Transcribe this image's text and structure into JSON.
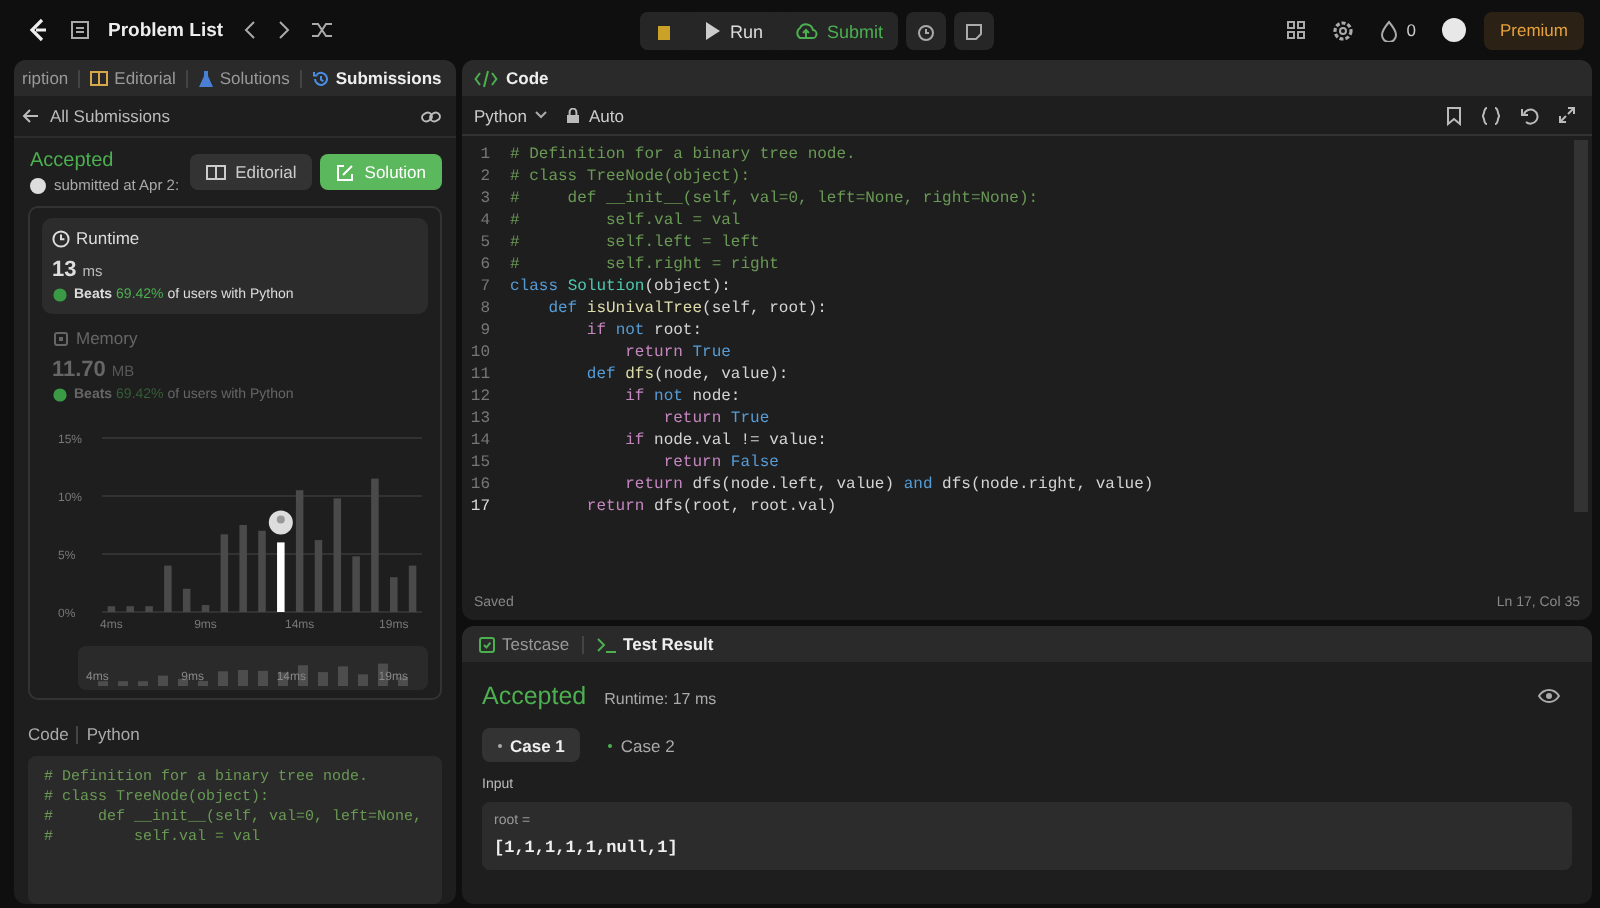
{
  "topbar": {
    "title": "Problem List",
    "run": "Run",
    "submit": "Submit",
    "streak": "0",
    "premium": "Premium"
  },
  "left": {
    "tabs": [
      {
        "label": "ription",
        "selected": false
      },
      {
        "label": "Editorial",
        "selected": false
      },
      {
        "label": "Solutions",
        "selected": false
      },
      {
        "label": "Submissions",
        "selected": true
      }
    ],
    "back": "All Submissions",
    "status": "Accepted",
    "submitted": "submitted at Apr 2:",
    "editorial_button": "Editorial",
    "solution_button": "Solution",
    "stats": [
      {
        "kind": "clock",
        "label": "Runtime",
        "value": "13",
        "unit": "ms",
        "beats": "Beats",
        "percent": "69.42%",
        "rest": "of users with Python",
        "selected": true
      },
      {
        "kind": "chip",
        "label": "Memory",
        "value": "11.70",
        "unit": "MB",
        "beats": "Beats",
        "percent": "69.42%",
        "rest": "of users with Python",
        "selected": false
      }
    ],
    "chart": {
      "chart_data": {
        "type": "bar",
        "stacked": true,
        "categories": [
          "4ms",
          null,
          null,
          null,
          null,
          "9ms",
          null,
          null,
          null,
          null,
          "14ms",
          null,
          null,
          null,
          null,
          "19ms",
          null
        ],
        "series": [
          {
            "color": "#4a4a4a",
            "values": [
              0.5,
              0.5,
              0.5,
              4,
              2,
              0.6,
              6.7,
              7.5,
              7,
              null,
              10.5,
              6.2,
              9.8,
              4.8,
              11.5,
              3,
              4
            ]
          },
          {
            "color": "#ffffff",
            "values": [
              null,
              null,
              null,
              null,
              null,
              null,
              null,
              null,
              null,
              6,
              null,
              null,
              null,
              null,
              null,
              null,
              null
            ]
          }
        ],
        "ylim": [
          0,
          15
        ],
        "yticks": [
          {
            "value": 0,
            "label": "0%"
          },
          {
            "value": 5,
            "label": "5%"
          },
          {
            "value": 10,
            "label": "10%"
          },
          {
            "value": 15,
            "label": "15%"
          }
        ]
      },
      "overview_labels": [
        "4ms",
        "9ms",
        "14ms",
        "19ms"
      ]
    },
    "code_label": "Code",
    "code_lang": "Python",
    "code_preview": [
      "# Definition for a binary tree node.",
      "# class TreeNode(object):",
      "#     def __init__(self, val=0, left=None,",
      "#         self.val = val"
    ]
  },
  "editor": {
    "title": "Code",
    "language": "Python",
    "mode": "Auto",
    "saved": "Saved",
    "cursor": "Ln 17, Col 35",
    "lines": [
      {
        "n": "1",
        "segs": [
          {
            "t": "# Definition for a binary tree node.",
            "kind": "comment"
          }
        ]
      },
      {
        "n": "2",
        "segs": [
          {
            "t": "# class TreeNode(object):",
            "kind": "comment"
          }
        ]
      },
      {
        "n": "3",
        "segs": [
          {
            "t": "#     def __init__(self, val=0, left=None, right=None):",
            "kind": "comment"
          }
        ]
      },
      {
        "n": "4",
        "segs": [
          {
            "t": "#         self.val = val",
            "kind": "comment"
          }
        ]
      },
      {
        "n": "5",
        "segs": [
          {
            "t": "#         self.left = left",
            "kind": "comment"
          }
        ]
      },
      {
        "n": "6",
        "segs": [
          {
            "t": "#         self.right = right",
            "kind": "comment"
          }
        ]
      },
      {
        "n": "7",
        "segs": [
          {
            "t": "class ",
            "kind": "keyword"
          },
          {
            "t": "Solution",
            "kind": "type"
          },
          {
            "t": "(object):",
            "kind": "plain"
          }
        ]
      },
      {
        "n": "8",
        "segs": [
          {
            "t": "    def ",
            "kind": "keyword"
          },
          {
            "t": "isUnivalTree",
            "kind": "func"
          },
          {
            "t": "(self, root):",
            "kind": "plain"
          }
        ]
      },
      {
        "n": "9",
        "segs": [
          {
            "t": "        if ",
            "kind": "control"
          },
          {
            "t": "not ",
            "kind": "keyword"
          },
          {
            "t": "root:",
            "kind": "plain"
          }
        ]
      },
      {
        "n": "10",
        "segs": [
          {
            "t": "            return ",
            "kind": "control"
          },
          {
            "t": "True",
            "kind": "keyword"
          }
        ]
      },
      {
        "n": "11",
        "segs": [
          {
            "t": "        def ",
            "kind": "keyword"
          },
          {
            "t": "dfs",
            "kind": "func"
          },
          {
            "t": "(node, value):",
            "kind": "plain"
          }
        ]
      },
      {
        "n": "12",
        "segs": [
          {
            "t": "            if ",
            "kind": "control"
          },
          {
            "t": "not ",
            "kind": "keyword"
          },
          {
            "t": "node:",
            "kind": "plain"
          }
        ]
      },
      {
        "n": "13",
        "segs": [
          {
            "t": "                return ",
            "kind": "control"
          },
          {
            "t": "True",
            "kind": "keyword"
          }
        ]
      },
      {
        "n": "14",
        "segs": [
          {
            "t": "            if ",
            "kind": "control"
          },
          {
            "t": "node.val != value:",
            "kind": "plain"
          }
        ]
      },
      {
        "n": "15",
        "segs": [
          {
            "t": "                return ",
            "kind": "control"
          },
          {
            "t": "False",
            "kind": "keyword"
          }
        ]
      },
      {
        "n": "16",
        "segs": [
          {
            "t": "            return ",
            "kind": "control"
          },
          {
            "t": "dfs(node.left, value) ",
            "kind": "plain"
          },
          {
            "t": "and ",
            "kind": "keyword"
          },
          {
            "t": "dfs(node.right, value)",
            "kind": "plain"
          }
        ]
      },
      {
        "n": "17",
        "current": true,
        "segs": [
          {
            "t": "        return ",
            "kind": "control"
          },
          {
            "t": "dfs(root, root.val)",
            "kind": "plain"
          }
        ]
      }
    ]
  },
  "result": {
    "tabs": [
      {
        "label": "Testcase",
        "selected": false
      },
      {
        "label": "Test Result",
        "selected": true
      }
    ],
    "status": "Accepted",
    "runtime": "Runtime: 17 ms",
    "cases": [
      {
        "label": "Case 1",
        "selected": true
      },
      {
        "label": "Case 2",
        "selected": false
      }
    ],
    "input_label": "Input",
    "var": "root =",
    "value": "[1,1,1,1,1,null,1]"
  }
}
